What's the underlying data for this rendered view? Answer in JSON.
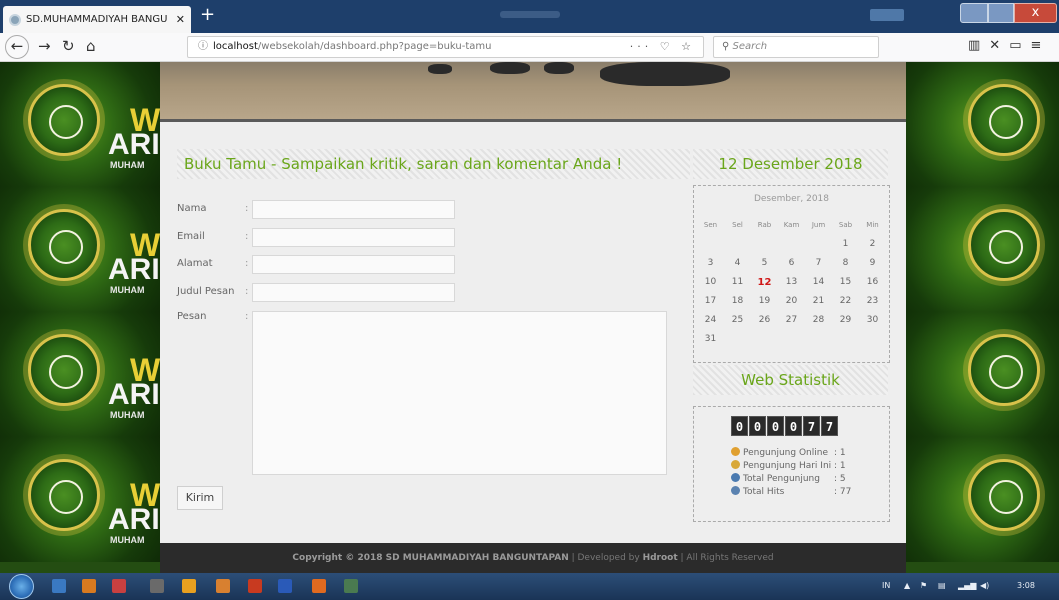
{
  "browser": {
    "tab_title": "SD.MUHAMMADIYAH BANGU",
    "tab_close": "✕",
    "new_tab": "+",
    "url_host": "localhost",
    "url_path": "/websekolah/dashboard.php?page=buku-tamu",
    "url_actions": "··· ♡ ☆",
    "search_placeholder": "Search",
    "window_close": "x"
  },
  "logo_tile": {
    "w": "W",
    "ar": "ARI",
    "muham": "MUHAM"
  },
  "guestbook": {
    "title": "Buku Tamu - Sampaikan kritik, saran dan komentar Anda !",
    "fields": [
      {
        "label": "Nama",
        "colon": ":"
      },
      {
        "label": "Email",
        "colon": ":"
      },
      {
        "label": "Alamat",
        "colon": ":"
      },
      {
        "label": "Judul Pesan",
        "colon": ":"
      },
      {
        "label": "Pesan",
        "colon": ":"
      }
    ],
    "submit_label": "Kirim"
  },
  "calendar": {
    "date_title": "12 Desember 2018",
    "month_label": "Desember, 2018",
    "weekdays": [
      "Sen",
      "Sel",
      "Rab",
      "Kam",
      "Jum",
      "Sab",
      "Min"
    ],
    "weeks": [
      [
        "",
        "",
        "",
        "",
        "",
        "1",
        "2"
      ],
      [
        "3",
        "4",
        "5",
        "6",
        "7",
        "8",
        "9"
      ],
      [
        "10",
        "11",
        "12",
        "13",
        "14",
        "15",
        "16"
      ],
      [
        "17",
        "18",
        "19",
        "20",
        "21",
        "22",
        "23"
      ],
      [
        "24",
        "25",
        "26",
        "27",
        "28",
        "29",
        "30"
      ],
      [
        "31",
        "",
        "",
        "",
        "",
        "",
        ""
      ]
    ],
    "today": "12"
  },
  "stats": {
    "title": "Web Statistik",
    "counter_digits": [
      "0",
      "0",
      "0",
      "0",
      "7",
      "7"
    ],
    "items": [
      {
        "label": "Pengunjung Online",
        "value": ": 1",
        "icon": "users-icon",
        "color": "#e0a030"
      },
      {
        "label": "Pengunjung Hari Ini",
        "value": ": 1",
        "icon": "users-icon",
        "color": "#d8a838"
      },
      {
        "label": "Total Pengunjung",
        "value": ": 5",
        "icon": "users-icon",
        "color": "#4a7ab0"
      },
      {
        "label": "Total Hits",
        "value": ": 77",
        "icon": "users-icon",
        "color": "#5a82b0"
      }
    ]
  },
  "footer": {
    "copyright": "Copyright © 2018 SD MUHAMMADIYAH BANGUNTAPAN",
    "separator1": " | Developed by ",
    "developer": "Hdroot",
    "rights": " | All Rights Reserved"
  },
  "taskbar": {
    "lang": "IN",
    "time": "3:08"
  },
  "colors": {
    "accent_green": "#6aa61a",
    "today_red": "#d01818",
    "titlebar": "#1e3f6b"
  }
}
